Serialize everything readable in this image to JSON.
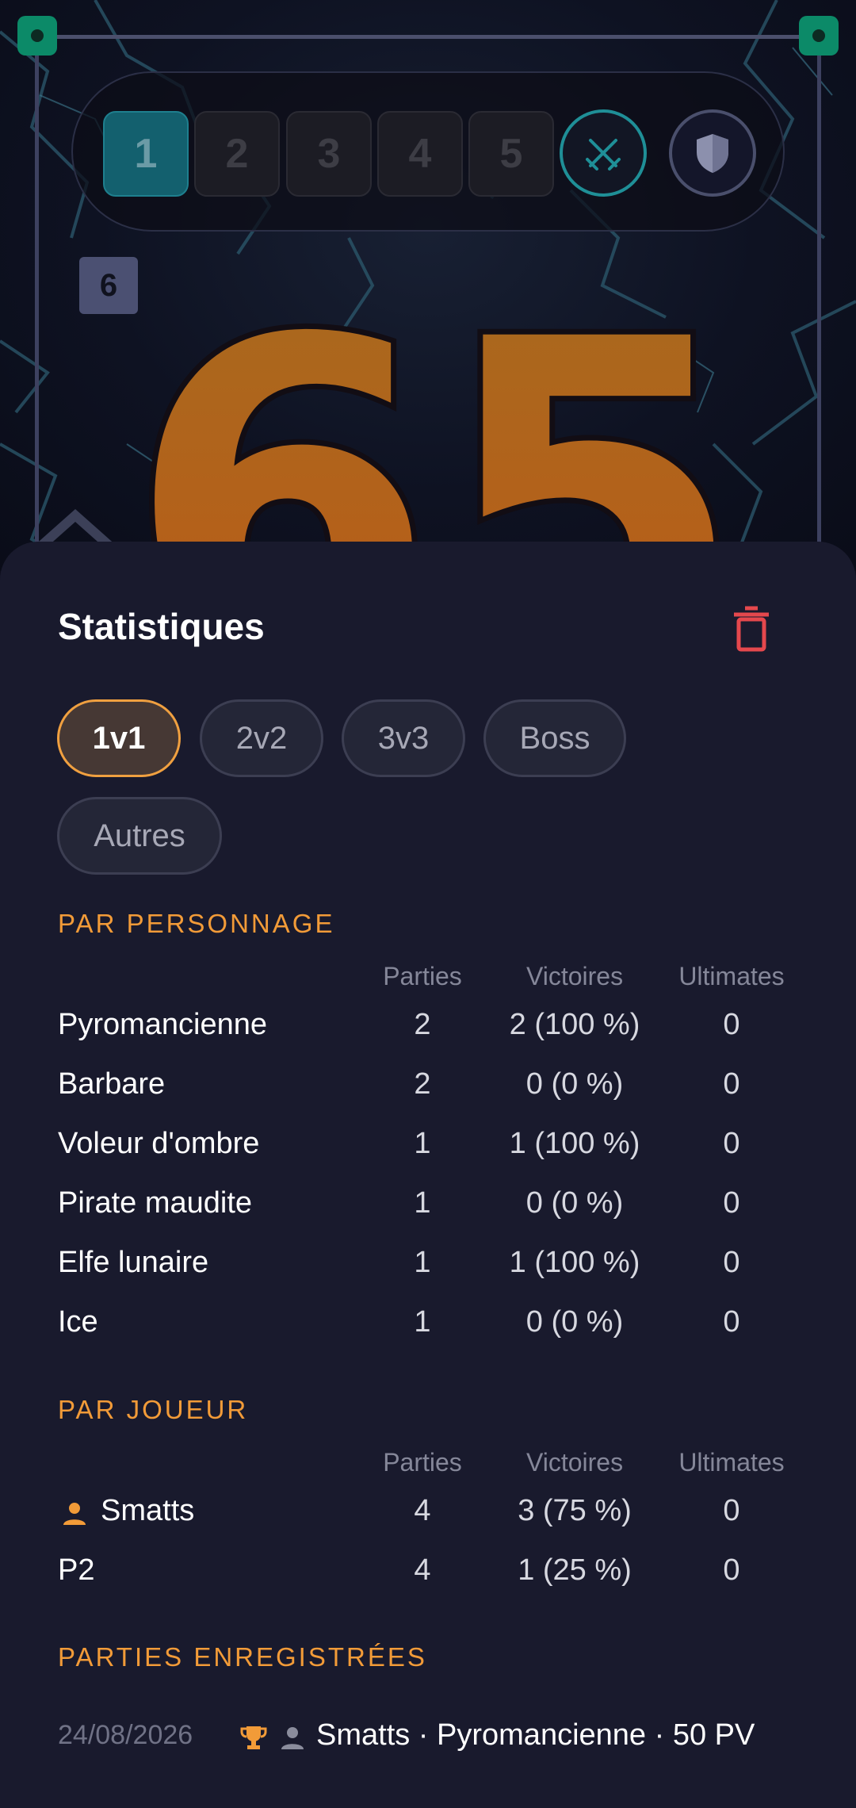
{
  "game": {
    "rounds": [
      "1",
      "2",
      "3",
      "4",
      "5"
    ],
    "active_round": "1",
    "turn_badge": "6",
    "score": "65",
    "icons": [
      "swords-icon",
      "shield-icon"
    ]
  },
  "stats": {
    "title": "Statistiques",
    "delete_icon": "trash-icon",
    "delete_color": "#e5484d",
    "accent_color": "#f29b38",
    "filters": [
      "1v1",
      "2v2",
      "3v3",
      "Boss",
      "Autres"
    ],
    "active_filter": "1v1",
    "columns": [
      "Parties",
      "Victoires",
      "Ultimates"
    ],
    "by_character": {
      "label": "PAR PERSONNAGE",
      "rows": [
        {
          "name": "Pyromancienne",
          "games": "2",
          "wins": "2 (100 %)",
          "ultimates": "0"
        },
        {
          "name": "Barbare",
          "games": "2",
          "wins": "0 (0 %)",
          "ultimates": "0"
        },
        {
          "name": "Voleur d'ombre",
          "games": "1",
          "wins": "1 (100 %)",
          "ultimates": "0"
        },
        {
          "name": "Pirate maudite",
          "games": "1",
          "wins": "0 (0 %)",
          "ultimates": "0"
        },
        {
          "name": "Elfe lunaire",
          "games": "1",
          "wins": "1 (100 %)",
          "ultimates": "0"
        },
        {
          "name": "Ice",
          "games": "1",
          "wins": "0 (0 %)",
          "ultimates": "0"
        }
      ]
    },
    "by_player": {
      "label": "PAR JOUEUR",
      "rows": [
        {
          "name": "Smatts",
          "icon": "person-icon",
          "games": "4",
          "wins": "3 (75 %)",
          "ultimates": "0"
        },
        {
          "name": "P2",
          "games": "4",
          "wins": "1 (25 %)",
          "ultimates": "0"
        }
      ]
    },
    "saved_matches": {
      "label": "PARTIES ENREGISTRÉES",
      "items": [
        {
          "date": "24/08/2026",
          "icons": [
            "trophy-icon",
            "person-icon"
          ],
          "summary": "Smatts · Pyromancienne · 50 PV"
        }
      ]
    }
  }
}
